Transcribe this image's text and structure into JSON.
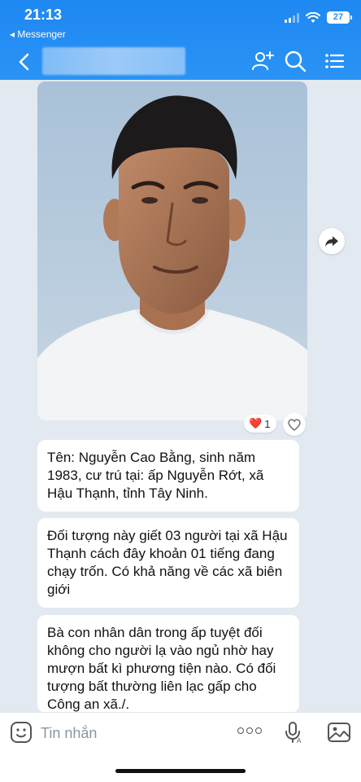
{
  "status_bar": {
    "time": "21:13",
    "back_app": "◂ Messenger",
    "battery": "27"
  },
  "header": {
    "contact_name": ""
  },
  "photo": {
    "reaction_emoji": "❤️",
    "reaction_count": "1"
  },
  "messages": [
    {
      "text": "Tên: Nguyễn Cao Bằng, sinh năm 1983, cư trú tại: ấp Nguyễn Rớt, xã Hậu Thạnh, tỉnh Tây Ninh."
    },
    {
      "text": "Đối tượng này giết 03 người tại xã Hậu Thạnh cách đây khoản 01 tiếng đang chạy trốn. Có khả năng về các xã biên giới"
    },
    {
      "text": "Bà con nhân dân trong ấp tuyệt đối không cho người lạ vào ngủ nhờ hay mượn bất kì phương tiện nào. Có đối tượng bất thường liên lạc gấp cho Công an xã./."
    }
  ],
  "composer": {
    "placeholder": "Tin nhắn"
  },
  "colors": {
    "header": "#2a93f5",
    "chat_bg": "#e2e9f1",
    "heart": "#e0245e"
  },
  "icons": [
    "chevron-left-icon",
    "add-user-icon",
    "search-icon",
    "list-menu-icon",
    "share-icon",
    "heart-icon",
    "emoji-icon",
    "more-icon",
    "mic-icon",
    "image-icon"
  ]
}
